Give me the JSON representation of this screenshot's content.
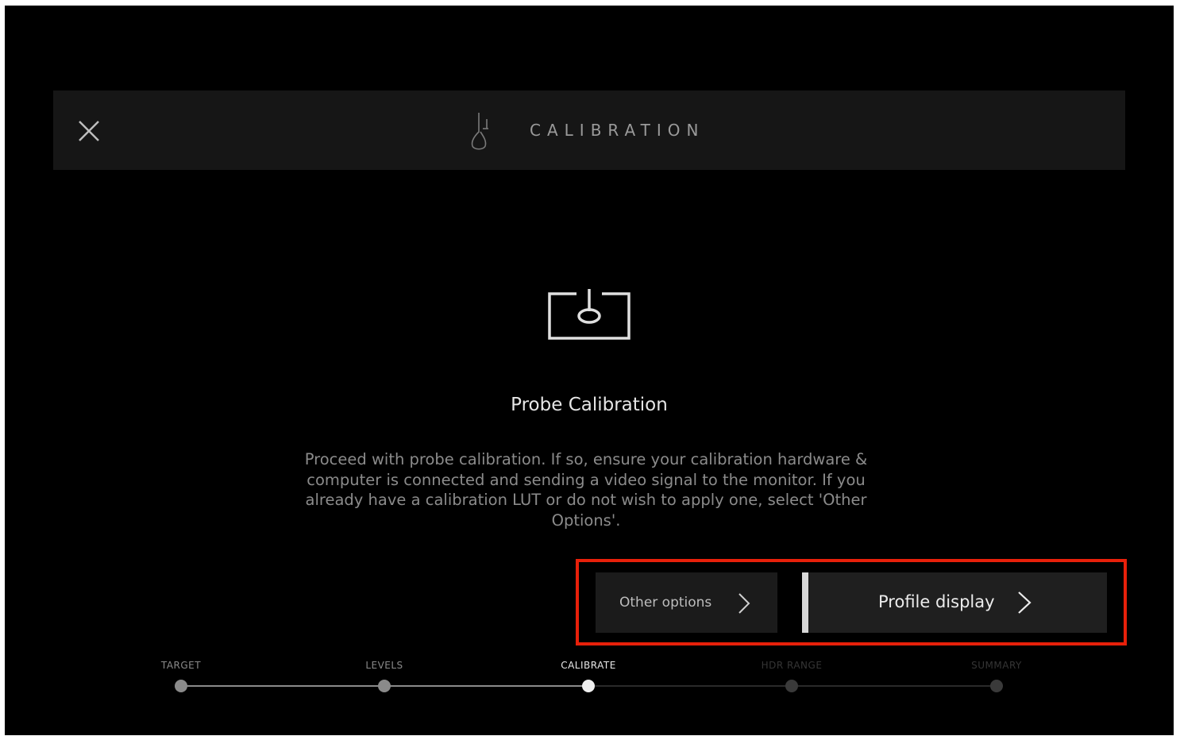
{
  "header": {
    "title": "CALIBRATION",
    "close_icon": "close-icon",
    "logo_icon": "probe-drop-icon"
  },
  "main": {
    "icon": "probe-on-screen-icon",
    "title": "Probe Calibration",
    "description": "Proceed with probe calibration. If so, ensure your calibration hardware & computer is connected and sending a video signal to the monitor. If you already have a calibration LUT or do not wish to apply one, select 'Other Options'."
  },
  "actions": {
    "other_options_label": "Other options",
    "profile_display_label": "Profile display",
    "highlight_color": "#e8200a"
  },
  "steps": [
    {
      "label": "TARGET",
      "state": "done"
    },
    {
      "label": "LEVELS",
      "state": "done"
    },
    {
      "label": "CALIBRATE",
      "state": "active"
    },
    {
      "label": "HDR RANGE",
      "state": "todo"
    },
    {
      "label": "SUMMARY",
      "state": "todo"
    }
  ],
  "colors": {
    "background": "#000000",
    "header_bg": "#161616",
    "button_bg": "#1b1b1b",
    "accent_bar": "#d8d8d8"
  }
}
